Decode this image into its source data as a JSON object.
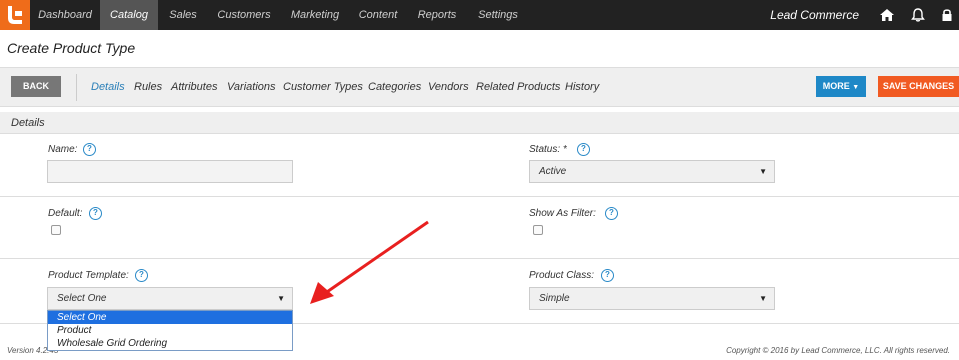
{
  "nav": {
    "items": [
      {
        "label": "Dashboard",
        "active": false
      },
      {
        "label": "Catalog",
        "active": true
      },
      {
        "label": "Sales",
        "active": false
      },
      {
        "label": "Customers",
        "active": false
      },
      {
        "label": "Marketing",
        "active": false
      },
      {
        "label": "Content",
        "active": false
      },
      {
        "label": "Reports",
        "active": false
      },
      {
        "label": "Settings",
        "active": false
      }
    ],
    "brand": "Lead Commerce",
    "icons": [
      "home-icon",
      "bell-icon",
      "lock-icon"
    ]
  },
  "page": {
    "title": "Create Product Type"
  },
  "toolbar": {
    "back_label": "BACK",
    "tabs": [
      "Details",
      "Rules",
      "Attributes",
      "Variations",
      "Customer Types",
      "Categories",
      "Vendors",
      "Related Products",
      "History"
    ],
    "active_tab": "Details",
    "more_label": "MORE",
    "save_label": "SAVE CHANGES",
    "colors": {
      "more": "#1e88c7",
      "save": "#f15a22"
    }
  },
  "section": {
    "title": "Details"
  },
  "form": {
    "name": {
      "label": "Name:",
      "value": ""
    },
    "status": {
      "label": "Status: *",
      "value": "Active"
    },
    "default": {
      "label": "Default:",
      "checked": false
    },
    "show_as_filter": {
      "label": "Show As Filter:",
      "checked": false
    },
    "product_template": {
      "label": "Product Template:",
      "value": "Select One",
      "options": [
        "Select One",
        "Product",
        "Wholesale Grid Ordering"
      ]
    },
    "product_class": {
      "label": "Product Class:",
      "value": "Simple"
    }
  },
  "footer": {
    "version": "Version 4.2.43",
    "copyright": "Copyright © 2016 by Lead Commerce, LLC. All rights reserved."
  }
}
